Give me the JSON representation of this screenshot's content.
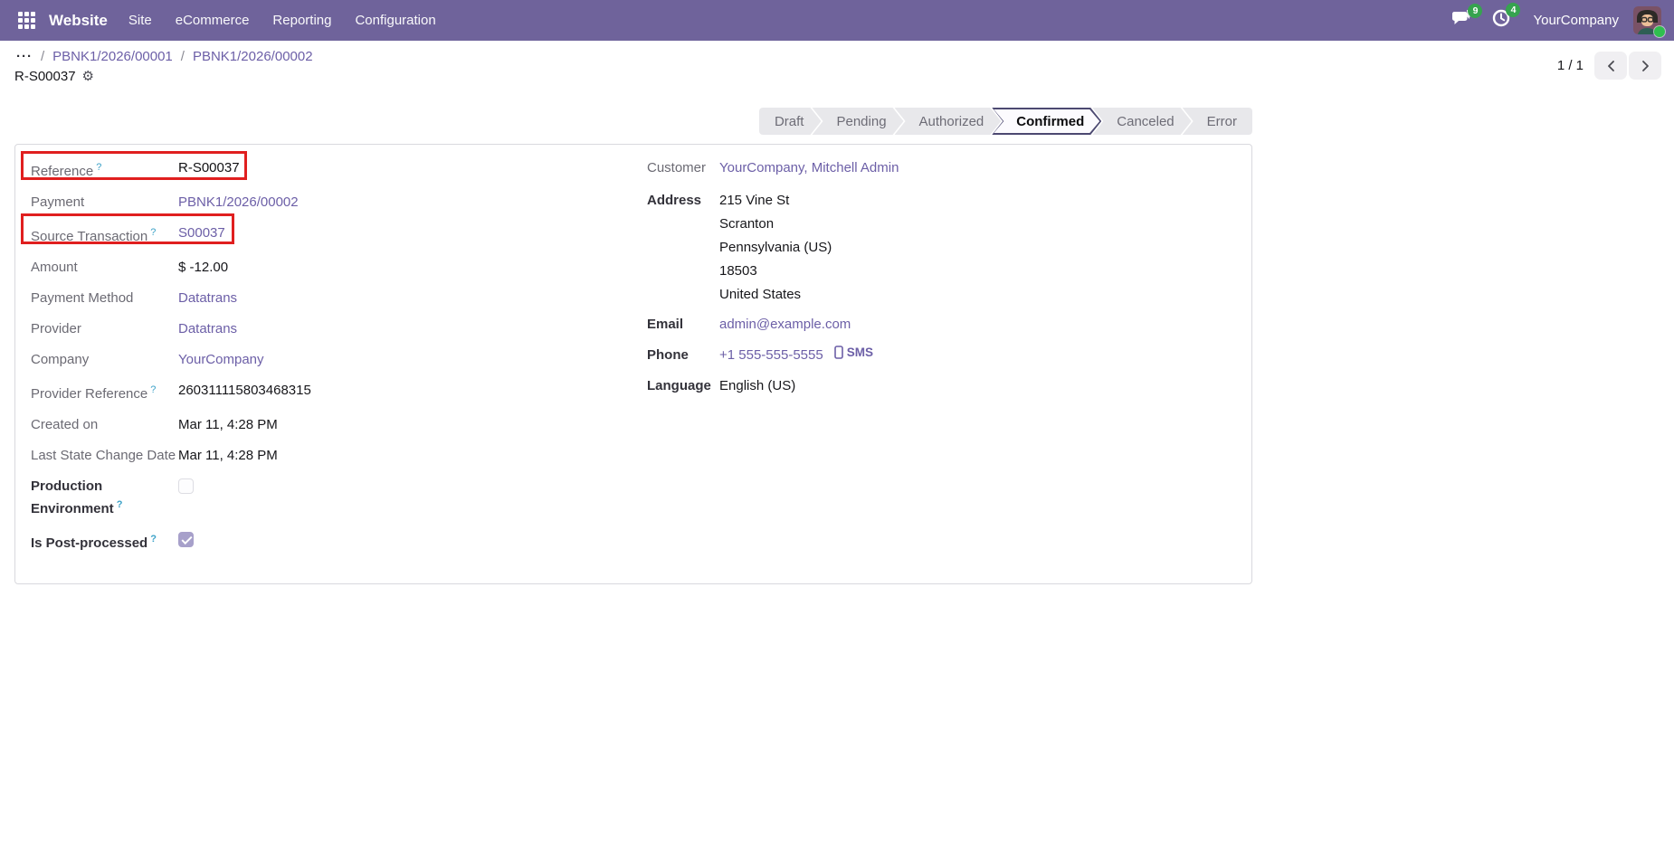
{
  "nav": {
    "brand": "Website",
    "items": [
      "Site",
      "eCommerce",
      "Reporting",
      "Configuration"
    ],
    "company": "YourCompany",
    "badges": {
      "messages": "9",
      "activities": "4"
    }
  },
  "breadcrumb": {
    "ellipsis": "···",
    "separator": "/",
    "links": [
      "PBNK1/2026/00001",
      "PBNK1/2026/00002"
    ],
    "title": "R-S00037"
  },
  "pager": {
    "display": "1 / 1"
  },
  "statusbar": {
    "steps": [
      {
        "label": "Draft",
        "active": false
      },
      {
        "label": "Pending",
        "active": false
      },
      {
        "label": "Authorized",
        "active": false
      },
      {
        "label": "Confirmed",
        "active": true
      },
      {
        "label": "Canceled",
        "active": false
      },
      {
        "label": "Error",
        "active": false
      }
    ]
  },
  "form": {
    "left_fields": [
      {
        "label": "Reference",
        "help": true,
        "value": "R-S00037",
        "type": "text",
        "highlighted": true
      },
      {
        "label": "Payment",
        "help": false,
        "value": "PBNK1/2026/00002",
        "type": "link",
        "highlighted": false
      },
      {
        "label": "Source Transaction",
        "help": true,
        "value": "S00037",
        "type": "link",
        "highlighted": true
      },
      {
        "label": "Amount",
        "help": false,
        "value": "$ -12.00",
        "type": "text",
        "highlighted": false
      },
      {
        "label": "Payment Method",
        "help": false,
        "value": "Datatrans",
        "type": "link",
        "highlighted": false
      },
      {
        "label": "Provider",
        "help": false,
        "value": "Datatrans",
        "type": "link",
        "highlighted": false
      },
      {
        "label": "Company",
        "help": false,
        "value": "YourCompany",
        "type": "link",
        "highlighted": false
      },
      {
        "label": "Provider Reference",
        "help": true,
        "value": "260311115803468315",
        "type": "text",
        "highlighted": false
      },
      {
        "label": "Created on",
        "help": false,
        "value": "Mar 11, 4:28 PM",
        "type": "text",
        "highlighted": false
      },
      {
        "label": "Last State Change Date",
        "help": false,
        "value": "Mar 11, 4:28 PM",
        "type": "text",
        "highlighted": false
      },
      {
        "label": "Production Environment",
        "help": true,
        "value": "",
        "type": "checkbox",
        "checked": false,
        "highlighted": false
      },
      {
        "label": "Is Post-processed",
        "help": true,
        "value": "",
        "type": "checkbox",
        "checked": true,
        "highlighted": false
      }
    ],
    "right": {
      "customer": {
        "label": "Customer",
        "value": "YourCompany, Mitchell Admin"
      },
      "address": {
        "label": "Address",
        "lines": [
          "215 Vine St",
          "Scranton",
          "Pennsylvania (US)",
          "18503",
          "United States"
        ]
      },
      "email": {
        "label": "Email",
        "value": "admin@example.com"
      },
      "phone": {
        "label": "Phone",
        "value": "+1 555-555-5555",
        "sms_label": "SMS"
      },
      "language": {
        "label": "Language",
        "value": "English (US)"
      }
    }
  },
  "icons": {
    "help": "?",
    "gear": "⚙"
  },
  "colors": {
    "navbar": "#6F639B",
    "link": "#6C5FA7",
    "highlight": "#E01F1F",
    "badge": "#36A34F",
    "active_step_border": "#4C4971",
    "checked_checkbox": "#A7A0CA"
  }
}
